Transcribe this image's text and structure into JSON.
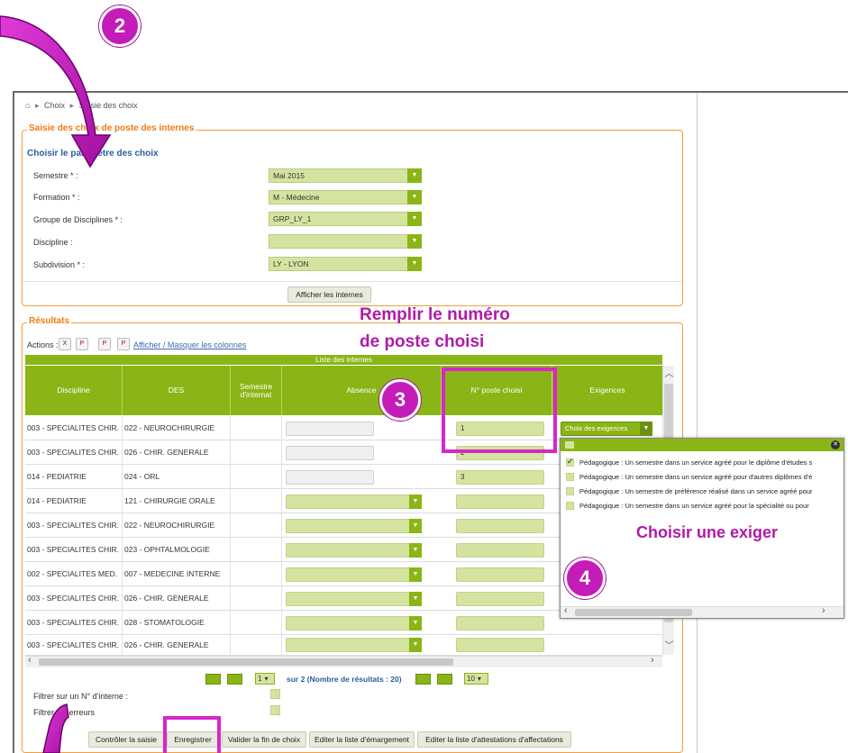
{
  "breadcrumb": {
    "home_icon": "home-icon",
    "choix": "Choix",
    "saisie": "Saisie des choix"
  },
  "params": {
    "legend": "Saisie des choix de poste des internes",
    "subtitle": "Choisir le paramètre des choix",
    "fields": [
      {
        "label": "Semestre * :",
        "value": "Mai 2015"
      },
      {
        "label": "Formation * :",
        "value": "M - Médecine"
      },
      {
        "label": "Groupe de Disciplines * :",
        "value": "GRP_LY_1"
      },
      {
        "label": "Discipline :",
        "value": ""
      },
      {
        "label": "Subdivision * :",
        "value": "LY - LYON"
      }
    ],
    "show_button": "Afficher les internes"
  },
  "results": {
    "legend": "Résultats",
    "actions_label": "Actions :",
    "toggle_columns": "Afficher / Masquer les colonnes",
    "table_title": "Liste des internes",
    "columns": [
      "Discipline",
      "DES",
      "Semestre d'internat",
      "Absence",
      "N° poste choisi",
      "Exigences"
    ],
    "exigences_select": "Choix des exigences",
    "rows": [
      {
        "discipline": "003 - SPECIALITES CHIR.",
        "des": "022 - NEUROCHIRURGIE",
        "poste": "1"
      },
      {
        "discipline": "003 - SPECIALITES CHIR.",
        "des": "026 - CHIR. GENERALE",
        "poste": "2"
      },
      {
        "discipline": "014 - PEDIATRIE",
        "des": "024 - ORL",
        "poste": "3"
      },
      {
        "discipline": "014 - PEDIATRIE",
        "des": "121 - CHIRURGIE ORALE",
        "poste": ""
      },
      {
        "discipline": "003 - SPECIALITES CHIR.",
        "des": "022 - NEUROCHIRURGIE",
        "poste": ""
      },
      {
        "discipline": "003 - SPECIALITES CHIR.",
        "des": "023 - OPHTALMOLOGIE",
        "poste": ""
      },
      {
        "discipline": "002 - SPECIALITES MED.",
        "des": "007 - MEDECINE INTERNE",
        "poste": ""
      },
      {
        "discipline": "003 - SPECIALITES CHIR.",
        "des": "026 - CHIR. GENERALE",
        "poste": ""
      },
      {
        "discipline": "003 - SPECIALITES CHIR.",
        "des": "028 - STOMATOLOGIE",
        "poste": ""
      },
      {
        "discipline": "003 - SPECIALITES CHIR.",
        "des": "026 - CHIR. GENERALE",
        "poste": ""
      }
    ],
    "pager": {
      "page": "1",
      "info": "sur 2 (Nombre de résultats : 20)",
      "per_page": "10"
    },
    "filter_intern": "Filtrer sur un N° d'interne :",
    "filter_errors": "Filtrer les erreurs"
  },
  "popup": {
    "items": [
      {
        "text": "Pédagogique : Un semestre dans un service agréé pour le diplôme d'études s",
        "checked": true
      },
      {
        "text": "Pédagogique : Un semestre dans un service agréé pour d'autres diplômes d'é",
        "checked": false
      },
      {
        "text": "Pédagogique : Un semestre de préférence réalisé dans un service agréé pour",
        "checked": false
      },
      {
        "text": "Pédagogique : Un semestre dans un service agréé pour la spécialité ou pour",
        "checked": false
      }
    ]
  },
  "footer_buttons": [
    "Contrôler la saisie",
    "Enregistrer",
    "Valider la fin de choix",
    "Editer la liste d'émargement",
    "Editer la liste d'attestations d'affectations"
  ],
  "annotations": {
    "step2": "2",
    "step3": "3",
    "step4": "4",
    "remplir_line1": "Remplir le numéro",
    "remplir_line2": "de  poste choisi",
    "choisir": "Choisir une exiger"
  },
  "colors": {
    "accent_green": "#8ab516",
    "legend_orange": "#f07a10",
    "annotation_magenta": "#c41cb8"
  }
}
